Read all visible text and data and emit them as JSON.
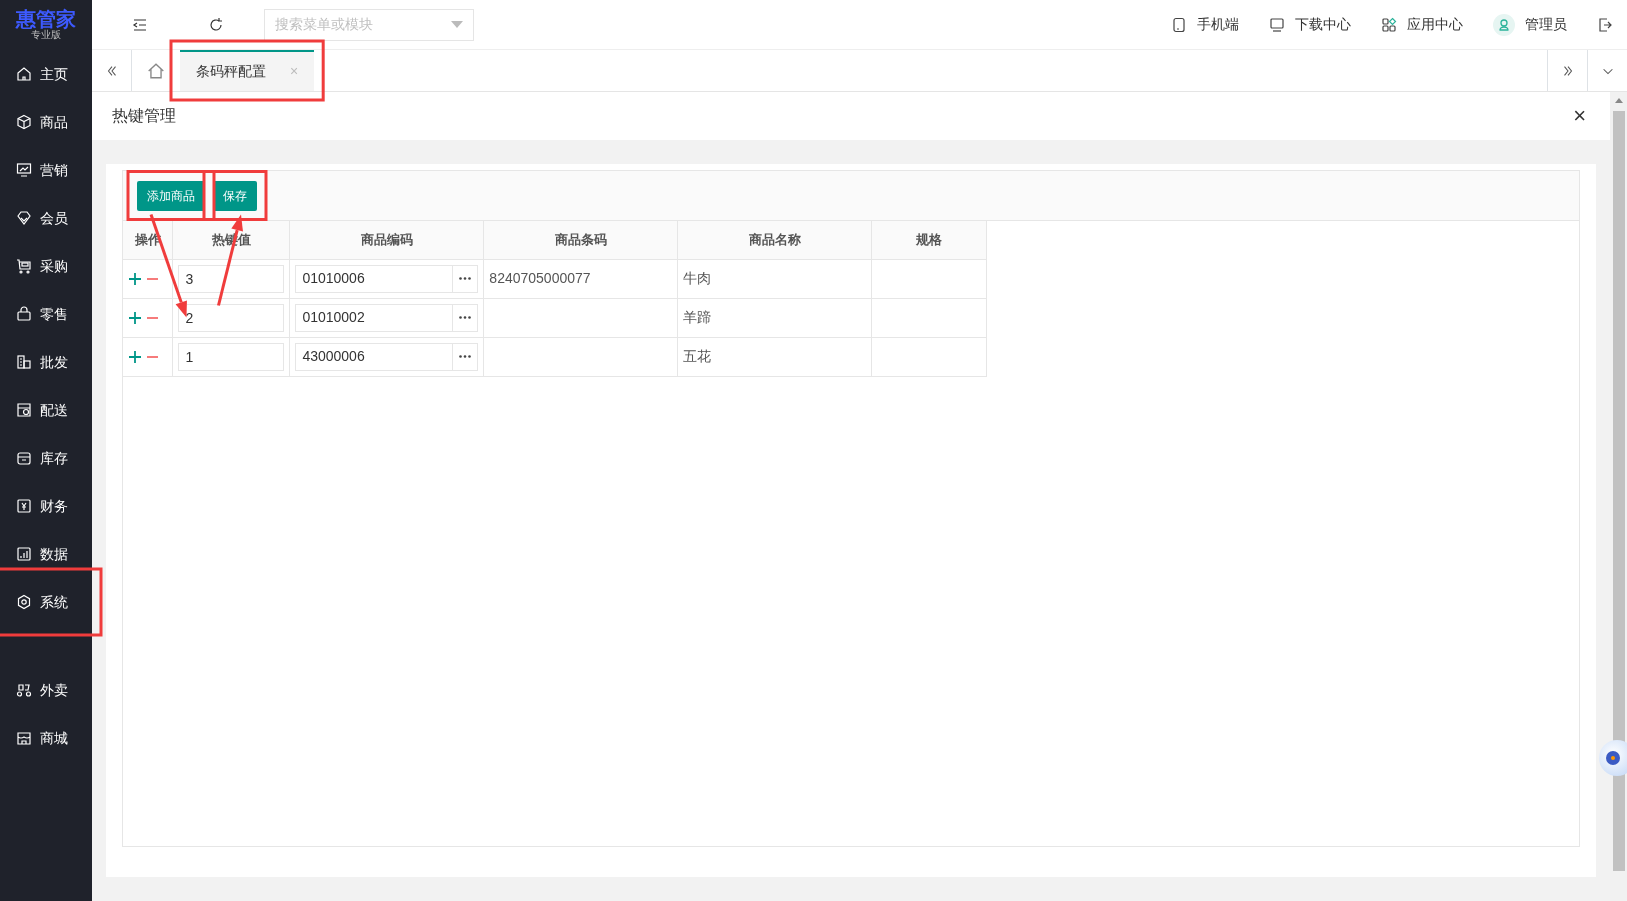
{
  "logo": {
    "title": "惠管家",
    "subtitle": "专业版"
  },
  "sidebar": {
    "items": [
      {
        "label": "主页"
      },
      {
        "label": "商品"
      },
      {
        "label": "营销"
      },
      {
        "label": "会员"
      },
      {
        "label": "采购"
      },
      {
        "label": "零售"
      },
      {
        "label": "批发"
      },
      {
        "label": "配送"
      },
      {
        "label": "库存"
      },
      {
        "label": "财务"
      },
      {
        "label": "数据"
      },
      {
        "label": "系统"
      }
    ],
    "extra_items": [
      {
        "label": "外卖"
      },
      {
        "label": "商城"
      }
    ]
  },
  "topbar": {
    "search": {
      "placeholder": "搜索菜单或模块"
    },
    "links": [
      "手机端",
      "下载中心",
      "应用中心",
      "管理员"
    ]
  },
  "tabs": [
    {
      "kind": "home",
      "selected": false
    },
    {
      "kind": "page",
      "label": "条码秤配置",
      "selected": true,
      "close": "×"
    }
  ],
  "panel": {
    "title": "热键管理",
    "close": "×",
    "buttons": [
      "添加商品",
      "保存"
    ],
    "table": {
      "columns": [
        "操作",
        "热键值",
        "商品编码",
        "商品条码",
        "商品名称",
        "规格"
      ],
      "rows": [
        {
          "hotkey": "3",
          "code": "01010006",
          "barcode": "8240705000077",
          "name": "牛肉"
        },
        {
          "hotkey": "2",
          "code": "01010002",
          "name": "羊蹄"
        },
        {
          "hotkey": "1",
          "code": "43000006",
          "name": "五花"
        }
      ]
    }
  },
  "annotations": [
    {
      "kind": "box"
    },
    {
      "kind": "box"
    },
    {
      "kind": "box"
    },
    {
      "kind": "box"
    },
    {
      "kind": "arrow"
    },
    {
      "kind": "arrow"
    }
  ]
}
